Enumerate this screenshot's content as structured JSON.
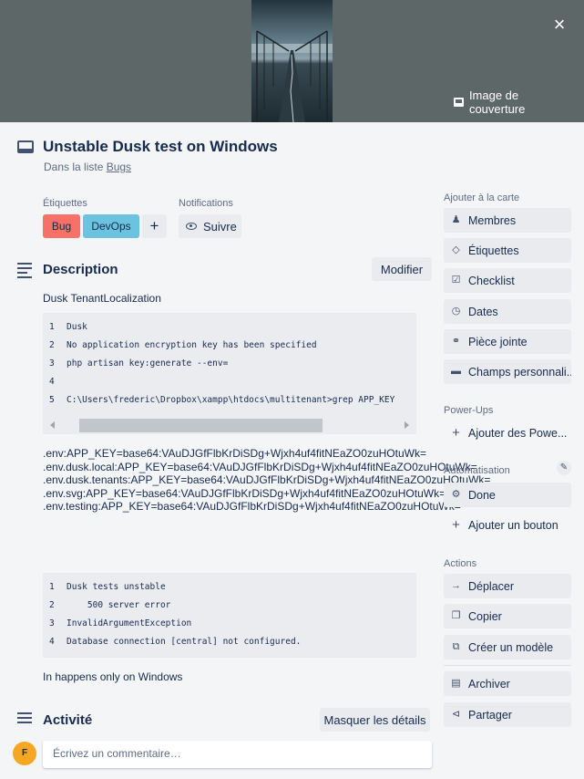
{
  "cover": {
    "button_label": "Image de couverture",
    "close": "×"
  },
  "card": {
    "title": "Unstable Dusk test on Windows",
    "in_list_prefix": "Dans la liste ",
    "list_name": "Bugs"
  },
  "labels": {
    "heading": "Étiquettes",
    "items": [
      {
        "text": "Bug",
        "color": "#f87168"
      },
      {
        "text": "DevOps",
        "color": "#6cc3e0"
      }
    ],
    "add": "+"
  },
  "notifications": {
    "heading": "Notifications",
    "button": "Suivre"
  },
  "description": {
    "title": "Description",
    "edit_button": "Modifier",
    "intro": "Dusk TenantLocalization",
    "code1": [
      {
        "n": "1",
        "t": "Dusk"
      },
      {
        "n": "2",
        "t": "No application encryption key has been specified"
      },
      {
        "n": "3",
        "t": "php artisan key:generate --env="
      },
      {
        "n": "4",
        "t": ""
      },
      {
        "n": "5",
        "t": "C:\\Users\\frederic\\Dropbox\\xampp\\htdocs\\multitenant>grep APP_KEY"
      }
    ],
    "env_lines": [
      ".env:APP_KEY=base64:VAuDJGfFlbKrDiSDg+Wjxh4uf4fitNEaZO0zuHOtuWk=",
      ".env.dusk.local:APP_KEY=base64:VAuDJGfFlbKrDiSDg+Wjxh4uf4fitNEaZO0zuHOtuWk=",
      ".env.dusk.tenants:APP_KEY=base64:VAuDJGfFlbKrDiSDg+Wjxh4uf4fitNEaZO0zuHOtuWk=",
      ".env.svg:APP_KEY=base64:VAuDJGfFlbKrDiSDg+Wjxh4uf4fitNEaZO0zuHOtuWk=",
      ".env.testing:APP_KEY=base64:VAuDJGfFlbKrDiSDg+Wjxh4uf4fitNEaZO0zuHOtuWk="
    ],
    "code2": [
      {
        "n": "1",
        "t": "Dusk tests unstable"
      },
      {
        "n": "2",
        "t": "    500 server error"
      },
      {
        "n": "3",
        "t": "InvalidArgumentException"
      },
      {
        "n": "4",
        "t": "Database connection [central] not configured."
      }
    ],
    "outro": "In happens only on Windows"
  },
  "activity": {
    "title": "Activité",
    "toggle_button": "Masquer les détails",
    "avatar_initial": "F",
    "comment_placeholder": "Écrivez un commentaire…"
  },
  "sidebar": {
    "add_heading": "Ajouter à la carte",
    "add_items": [
      {
        "label": "Membres",
        "icon": "user-icon"
      },
      {
        "label": "Étiquettes",
        "icon": "tag-icon"
      },
      {
        "label": "Checklist",
        "icon": "checklist-icon"
      },
      {
        "label": "Dates",
        "icon": "clock-icon"
      },
      {
        "label": "Pièce jointe",
        "icon": "paperclip-icon"
      },
      {
        "label": "Champs personnali...",
        "icon": "custom-fields-icon"
      }
    ],
    "powerups_heading": "Power-Ups",
    "powerups_add": "Ajouter des Powe...",
    "automation_heading": "Automatisation",
    "automation_items": [
      {
        "label": "Done",
        "icon": "gears-icon"
      }
    ],
    "automation_add": "Ajouter un bouton",
    "actions_heading": "Actions",
    "action_items": [
      {
        "label": "Déplacer",
        "icon": "arrow-right-icon"
      },
      {
        "label": "Copier",
        "icon": "copy-icon"
      },
      {
        "label": "Créer un modèle",
        "icon": "template-icon"
      }
    ],
    "archive": "Archiver",
    "share": "Partager"
  }
}
